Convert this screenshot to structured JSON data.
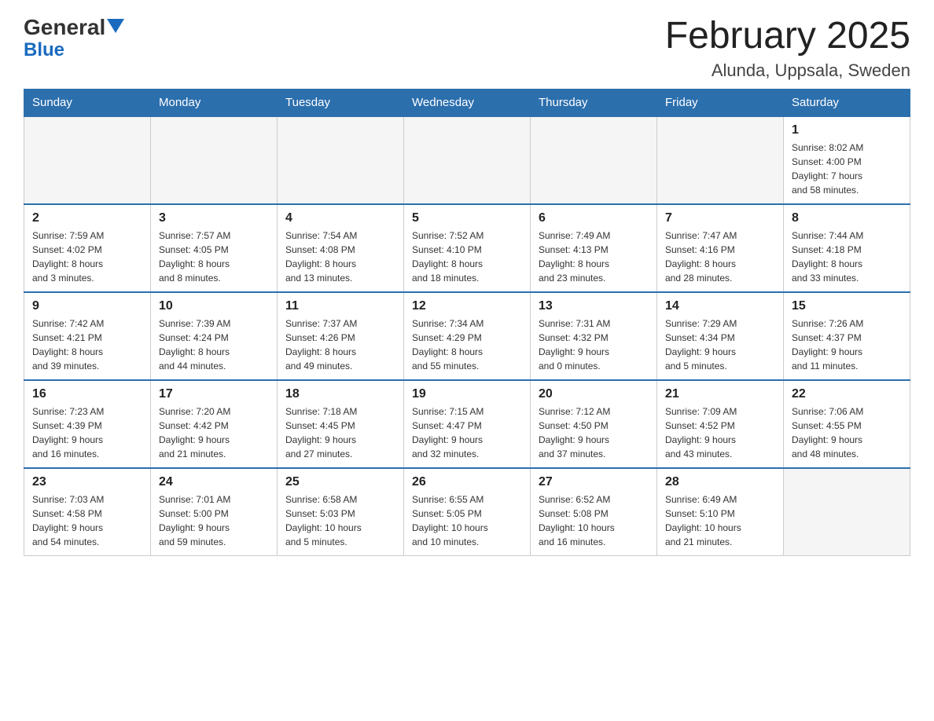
{
  "header": {
    "logo_text_general": "General",
    "logo_text_blue": "Blue",
    "month_title": "February 2025",
    "location": "Alunda, Uppsala, Sweden"
  },
  "weekdays": [
    "Sunday",
    "Monday",
    "Tuesday",
    "Wednesday",
    "Thursday",
    "Friday",
    "Saturday"
  ],
  "weeks": [
    [
      {
        "day": "",
        "info": ""
      },
      {
        "day": "",
        "info": ""
      },
      {
        "day": "",
        "info": ""
      },
      {
        "day": "",
        "info": ""
      },
      {
        "day": "",
        "info": ""
      },
      {
        "day": "",
        "info": ""
      },
      {
        "day": "1",
        "info": "Sunrise: 8:02 AM\nSunset: 4:00 PM\nDaylight: 7 hours\nand 58 minutes."
      }
    ],
    [
      {
        "day": "2",
        "info": "Sunrise: 7:59 AM\nSunset: 4:02 PM\nDaylight: 8 hours\nand 3 minutes."
      },
      {
        "day": "3",
        "info": "Sunrise: 7:57 AM\nSunset: 4:05 PM\nDaylight: 8 hours\nand 8 minutes."
      },
      {
        "day": "4",
        "info": "Sunrise: 7:54 AM\nSunset: 4:08 PM\nDaylight: 8 hours\nand 13 minutes."
      },
      {
        "day": "5",
        "info": "Sunrise: 7:52 AM\nSunset: 4:10 PM\nDaylight: 8 hours\nand 18 minutes."
      },
      {
        "day": "6",
        "info": "Sunrise: 7:49 AM\nSunset: 4:13 PM\nDaylight: 8 hours\nand 23 minutes."
      },
      {
        "day": "7",
        "info": "Sunrise: 7:47 AM\nSunset: 4:16 PM\nDaylight: 8 hours\nand 28 minutes."
      },
      {
        "day": "8",
        "info": "Sunrise: 7:44 AM\nSunset: 4:18 PM\nDaylight: 8 hours\nand 33 minutes."
      }
    ],
    [
      {
        "day": "9",
        "info": "Sunrise: 7:42 AM\nSunset: 4:21 PM\nDaylight: 8 hours\nand 39 minutes."
      },
      {
        "day": "10",
        "info": "Sunrise: 7:39 AM\nSunset: 4:24 PM\nDaylight: 8 hours\nand 44 minutes."
      },
      {
        "day": "11",
        "info": "Sunrise: 7:37 AM\nSunset: 4:26 PM\nDaylight: 8 hours\nand 49 minutes."
      },
      {
        "day": "12",
        "info": "Sunrise: 7:34 AM\nSunset: 4:29 PM\nDaylight: 8 hours\nand 55 minutes."
      },
      {
        "day": "13",
        "info": "Sunrise: 7:31 AM\nSunset: 4:32 PM\nDaylight: 9 hours\nand 0 minutes."
      },
      {
        "day": "14",
        "info": "Sunrise: 7:29 AM\nSunset: 4:34 PM\nDaylight: 9 hours\nand 5 minutes."
      },
      {
        "day": "15",
        "info": "Sunrise: 7:26 AM\nSunset: 4:37 PM\nDaylight: 9 hours\nand 11 minutes."
      }
    ],
    [
      {
        "day": "16",
        "info": "Sunrise: 7:23 AM\nSunset: 4:39 PM\nDaylight: 9 hours\nand 16 minutes."
      },
      {
        "day": "17",
        "info": "Sunrise: 7:20 AM\nSunset: 4:42 PM\nDaylight: 9 hours\nand 21 minutes."
      },
      {
        "day": "18",
        "info": "Sunrise: 7:18 AM\nSunset: 4:45 PM\nDaylight: 9 hours\nand 27 minutes."
      },
      {
        "day": "19",
        "info": "Sunrise: 7:15 AM\nSunset: 4:47 PM\nDaylight: 9 hours\nand 32 minutes."
      },
      {
        "day": "20",
        "info": "Sunrise: 7:12 AM\nSunset: 4:50 PM\nDaylight: 9 hours\nand 37 minutes."
      },
      {
        "day": "21",
        "info": "Sunrise: 7:09 AM\nSunset: 4:52 PM\nDaylight: 9 hours\nand 43 minutes."
      },
      {
        "day": "22",
        "info": "Sunrise: 7:06 AM\nSunset: 4:55 PM\nDaylight: 9 hours\nand 48 minutes."
      }
    ],
    [
      {
        "day": "23",
        "info": "Sunrise: 7:03 AM\nSunset: 4:58 PM\nDaylight: 9 hours\nand 54 minutes."
      },
      {
        "day": "24",
        "info": "Sunrise: 7:01 AM\nSunset: 5:00 PM\nDaylight: 9 hours\nand 59 minutes."
      },
      {
        "day": "25",
        "info": "Sunrise: 6:58 AM\nSunset: 5:03 PM\nDaylight: 10 hours\nand 5 minutes."
      },
      {
        "day": "26",
        "info": "Sunrise: 6:55 AM\nSunset: 5:05 PM\nDaylight: 10 hours\nand 10 minutes."
      },
      {
        "day": "27",
        "info": "Sunrise: 6:52 AM\nSunset: 5:08 PM\nDaylight: 10 hours\nand 16 minutes."
      },
      {
        "day": "28",
        "info": "Sunrise: 6:49 AM\nSunset: 5:10 PM\nDaylight: 10 hours\nand 21 minutes."
      },
      {
        "day": "",
        "info": ""
      }
    ]
  ]
}
